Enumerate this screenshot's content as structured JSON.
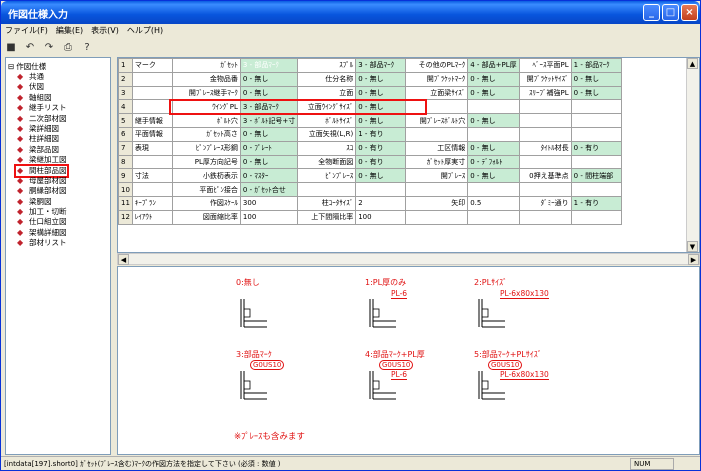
{
  "window": {
    "title": "作図仕様入力"
  },
  "menu": [
    "ファイル(F)",
    "編集(E)",
    "表示(V)",
    "ヘルプ(H)"
  ],
  "tree": {
    "root": "作図仕様",
    "items": [
      "共通",
      "伏図",
      "軸組図",
      "継手リスト",
      "二次部材図",
      "梁詳細図",
      "柱詳細図",
      "梁部品図",
      "梁継加工図",
      "間柱部品図",
      "母屋部材図",
      "胴縁部材図",
      "梁胴図",
      "加工・切断",
      "仕口組立図",
      "架構詳細図",
      "部材リスト"
    ],
    "selected_index": 9
  },
  "grid": {
    "rows": [
      {
        "n": "1",
        "sec": "マーク",
        "cells": [
          [
            "ｶﾞｾｯﾄ",
            "3 - 部品ﾏｰｸ"
          ],
          [
            "ｽﾌﾟﾙ",
            "3 - 部品ﾏｰｸ"
          ],
          [
            "その他のPLﾏｰｸ",
            "4 - 部品+PL厚"
          ],
          [
            "ﾍﾞｰｽ平面PL",
            "1 - 部品ﾏｰｸ"
          ]
        ]
      },
      {
        "n": "2",
        "sec": "",
        "cells": [
          [
            "金物品番",
            "0 - 無し"
          ],
          [
            "仕分名称",
            "0 - 無し"
          ],
          [
            "開ﾌﾞﾗｹｯﾄﾏｰｸ",
            "0 - 無し"
          ],
          [
            "開ﾌﾞﾗｹｯﾄｻｲｽﾞ",
            "0 - 無し"
          ]
        ]
      },
      {
        "n": "3",
        "sec": "",
        "cells": [
          [
            "開ﾌﾞﾚｰｽ継手ﾏｰｸ",
            "0 - 無し"
          ],
          [
            "立面",
            "0 - 無し"
          ],
          [
            "立面梁ｻｲｽﾞ",
            "0 - 無し"
          ],
          [
            "ｽﾘｰﾌﾞ補強PL",
            "0 - 無し"
          ]
        ]
      },
      {
        "n": "4",
        "sec": "",
        "cells": [
          [
            "ｳｲﾝｸﾞPL",
            "3 - 部品ﾏｰｸ"
          ],
          [
            "立面ｳｲﾝｸﾞｻｲｽﾞ",
            "0 - 無し"
          ],
          [
            "",
            ""
          ],
          [
            "",
            ""
          ]
        ]
      },
      {
        "n": "5",
        "sec": "継手情報",
        "cells": [
          [
            "ﾎﾞﾙﾄ穴",
            "3 - ﾎﾞﾙﾄ記号+寸"
          ],
          [
            "ﾎﾞﾙﾄｻｲｽﾞ",
            "0 - 無し"
          ],
          [
            "開ﾌﾞﾚｰｽﾎﾞﾙﾄ穴",
            "0 - 無し"
          ],
          [
            "",
            ""
          ]
        ]
      },
      {
        "n": "6",
        "sec": "平面情報",
        "cells": [
          [
            "ｶﾞｾｯﾄ高さ",
            "0 - 無し"
          ],
          [
            "立面矢視(L,R)",
            "1 - 有り"
          ],
          [
            "",
            ""
          ],
          [
            "",
            ""
          ]
        ]
      },
      {
        "n": "7",
        "sec": "表現",
        "cells": [
          [
            "ﾋﾟﾝﾌﾟﾚｰｽ形鋼",
            "0 - ﾌﾟﾚｰﾄ"
          ],
          [
            "ｽｺ",
            "0 - 有り"
          ],
          [
            "工区情報",
            "0 - 無し"
          ],
          [
            "ﾀｲﾄﾙ材長",
            "0 - 有り"
          ]
        ]
      },
      {
        "n": "8",
        "sec": "",
        "cells": [
          [
            "PL厚方向記号",
            "0 - 無し"
          ],
          [
            "全物断面図",
            "0 - 有り"
          ],
          [
            "ｶﾞｾｯﾄ厚実寸",
            "0 - ﾃﾞﾌｫﾙﾄ"
          ],
          [
            "",
            ""
          ]
        ]
      },
      {
        "n": "9",
        "sec": "寸法",
        "cells": [
          [
            "小鉄杤表示",
            "0 - ﾏｽﾀｰ"
          ],
          [
            "ﾋﾟﾝﾌﾟﾚｰｽ",
            "0 - 無し"
          ],
          [
            "開ﾌﾞﾚｰｽ",
            "0 - 無し"
          ],
          [
            "0押え基準点",
            "0 - 間柱端部"
          ]
        ]
      },
      {
        "n": "10",
        "sec": "",
        "cells": [
          [
            "平面ﾋﾟﾝ接合",
            "0 - ｶﾞｾｯﾄ合せ"
          ],
          [
            "",
            ""
          ],
          [
            "",
            ""
          ],
          [
            "",
            ""
          ]
        ]
      },
      {
        "n": "11",
        "sec": "ｷｰﾌﾟﾗﾝ",
        "cells": [
          [
            "作図ｽｹｰﾙ",
            "300"
          ],
          [
            "柱ｺｰﾀｻｲｽﾞ",
            "2"
          ],
          [
            "矢印",
            "0.5"
          ],
          [
            "ﾀﾞﾐｰ通り",
            "1 - 有り"
          ]
        ]
      },
      {
        "n": "12",
        "sec": "ﾚｲｱｳﾄ",
        "cells": [
          [
            "図面縮比率",
            "100"
          ],
          [
            "上下間隔比率",
            "100"
          ],
          [
            "",
            ""
          ],
          [
            "",
            ""
          ]
        ]
      }
    ]
  },
  "preview": {
    "options": [
      {
        "label": "0:無し",
        "mark": "",
        "pl": ""
      },
      {
        "label": "1:PL厚のみ",
        "mark": "",
        "pl": "PL-6"
      },
      {
        "label": "2:PLｻｲｽﾞ",
        "mark": "",
        "pl": "PL-6x80x130"
      },
      {
        "label": "3:部品ﾏｰｸ",
        "mark": "G0US10",
        "pl": ""
      },
      {
        "label": "4:部品ﾏｰｸ+PL厚",
        "mark": "G0US10",
        "pl": "PL-6"
      },
      {
        "label": "5:部品ﾏｰｸ+PLｻｲｽﾞ",
        "mark": "G0US10",
        "pl": "PL-6x80x130"
      }
    ],
    "note": "※ﾌﾟﾚｰｽも含みます"
  },
  "status": {
    "message": "[intdata[197].short0] ｶﾞｾｯﾄ(ﾌﾞﾚｰｽ含む)ﾏｰｸの作図方法を指定して下さい (必須 : 数値 )",
    "num": "NUM"
  },
  "colors": {
    "value_cell": "#c8ecd4",
    "highlight": "#ee1111",
    "note": "#e01010"
  }
}
